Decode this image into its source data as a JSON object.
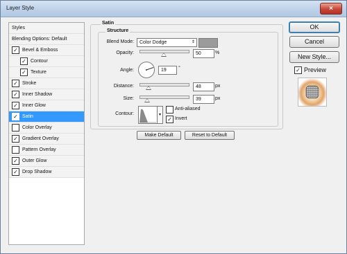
{
  "window": {
    "title": "Layer Style",
    "close_glyph": "×"
  },
  "sidebar": {
    "items": [
      {
        "label": "Styles",
        "checkbox": false,
        "checked": false,
        "indent": 0,
        "selected": false
      },
      {
        "label": "Blending Options: Default",
        "checkbox": false,
        "checked": false,
        "indent": 0,
        "selected": false
      },
      {
        "label": "Bevel & Emboss",
        "checkbox": true,
        "checked": true,
        "indent": 0,
        "selected": false
      },
      {
        "label": "Contour",
        "checkbox": true,
        "checked": true,
        "indent": 1,
        "selected": false
      },
      {
        "label": "Texture",
        "checkbox": true,
        "checked": true,
        "indent": 1,
        "selected": false
      },
      {
        "label": "Stroke",
        "checkbox": true,
        "checked": true,
        "indent": 0,
        "selected": false
      },
      {
        "label": "Inner Shadow",
        "checkbox": true,
        "checked": true,
        "indent": 0,
        "selected": false
      },
      {
        "label": "Inner Glow",
        "checkbox": true,
        "checked": true,
        "indent": 0,
        "selected": false
      },
      {
        "label": "Satin",
        "checkbox": true,
        "checked": true,
        "indent": 0,
        "selected": true
      },
      {
        "label": "Color Overlay",
        "checkbox": true,
        "checked": false,
        "indent": 0,
        "selected": false
      },
      {
        "label": "Gradient Overlay",
        "checkbox": true,
        "checked": true,
        "indent": 0,
        "selected": false
      },
      {
        "label": "Pattern Overlay",
        "checkbox": true,
        "checked": false,
        "indent": 0,
        "selected": false
      },
      {
        "label": "Outer Glow",
        "checkbox": true,
        "checked": true,
        "indent": 0,
        "selected": false
      },
      {
        "label": "Drop Shadow",
        "checkbox": true,
        "checked": true,
        "indent": 0,
        "selected": false
      }
    ]
  },
  "satin": {
    "section_title": "Satin",
    "structure_title": "Structure",
    "blend_mode": {
      "label": "Blend Mode:",
      "value": "Color Dodge",
      "arrow": "⇕",
      "swatch_color": "#9b9b9b"
    },
    "opacity": {
      "label": "Opacity:",
      "value": "50",
      "unit": "%",
      "level": 0.5
    },
    "angle": {
      "label": "Angle:",
      "value": "19",
      "unit": "°"
    },
    "distance": {
      "label": "Distance:",
      "value": "48",
      "unit": "px",
      "level": 0.19
    },
    "size": {
      "label": "Size:",
      "value": "39",
      "unit": "px",
      "level": 0.16
    },
    "contour": {
      "label": "Contour:",
      "arrow": "▾"
    },
    "anti_aliased": {
      "label": "Anti-aliased",
      "checked": false
    },
    "invert": {
      "label": "Invert",
      "checked": true
    },
    "make_default_label": "Make Default",
    "reset_default_label": "Reset to Default"
  },
  "actions": {
    "ok_label": "OK",
    "cancel_label": "Cancel",
    "new_style_label": "New Style...",
    "preview_label": "Preview",
    "preview_checked": true
  },
  "checkmark": "✓"
}
